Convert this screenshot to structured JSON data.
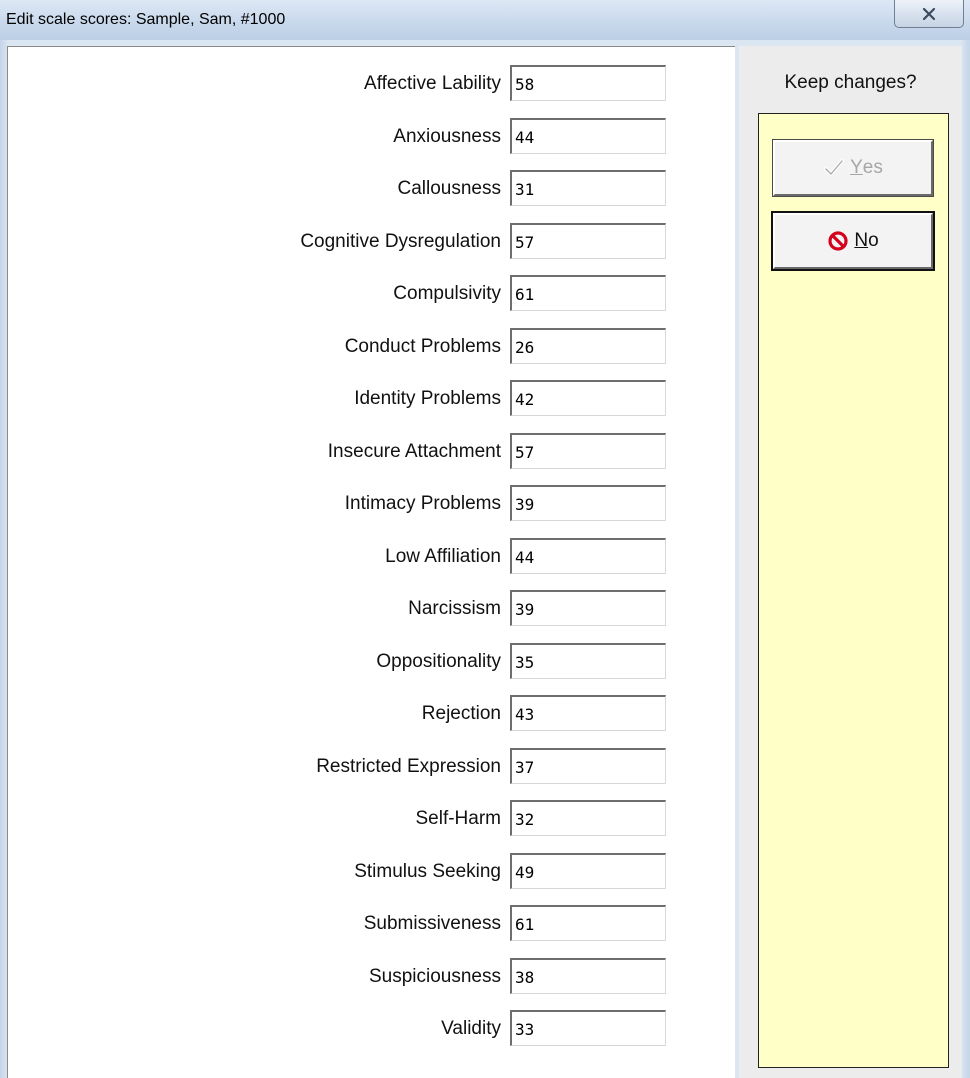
{
  "window": {
    "title": "Edit scale scores: Sample, Sam, #1000",
    "close_icon": "close-x-icon"
  },
  "scales": [
    {
      "label": "Affective Lability",
      "value": "58"
    },
    {
      "label": "Anxiousness",
      "value": "44"
    },
    {
      "label": "Callousness",
      "value": "31"
    },
    {
      "label": "Cognitive Dysregulation",
      "value": "57"
    },
    {
      "label": "Compulsivity",
      "value": "61"
    },
    {
      "label": "Conduct Problems",
      "value": "26"
    },
    {
      "label": "Identity Problems",
      "value": "42"
    },
    {
      "label": "Insecure Attachment",
      "value": "57"
    },
    {
      "label": "Intimacy Problems",
      "value": "39"
    },
    {
      "label": "Low Affiliation",
      "value": "44"
    },
    {
      "label": "Narcissism",
      "value": "39"
    },
    {
      "label": "Oppositionality",
      "value": "35"
    },
    {
      "label": "Rejection",
      "value": "43"
    },
    {
      "label": "Restricted Expression",
      "value": "37"
    },
    {
      "label": "Self-Harm",
      "value": "32"
    },
    {
      "label": "Stimulus Seeking",
      "value": "49"
    },
    {
      "label": "Submissiveness",
      "value": "61"
    },
    {
      "label": "Suspiciousness",
      "value": "38"
    },
    {
      "label": "Validity",
      "value": "33"
    }
  ],
  "actions": {
    "prompt": "Keep changes?",
    "yes": {
      "mnemonic": "Y",
      "rest": "es",
      "icon": "checkmark-icon",
      "enabled": false
    },
    "no": {
      "mnemonic": "N",
      "rest": "o",
      "icon": "prohibited-icon",
      "enabled": true
    }
  },
  "colors": {
    "action_panel_bg": "#ffffc8",
    "no_icon_red": "#d4001c"
  }
}
